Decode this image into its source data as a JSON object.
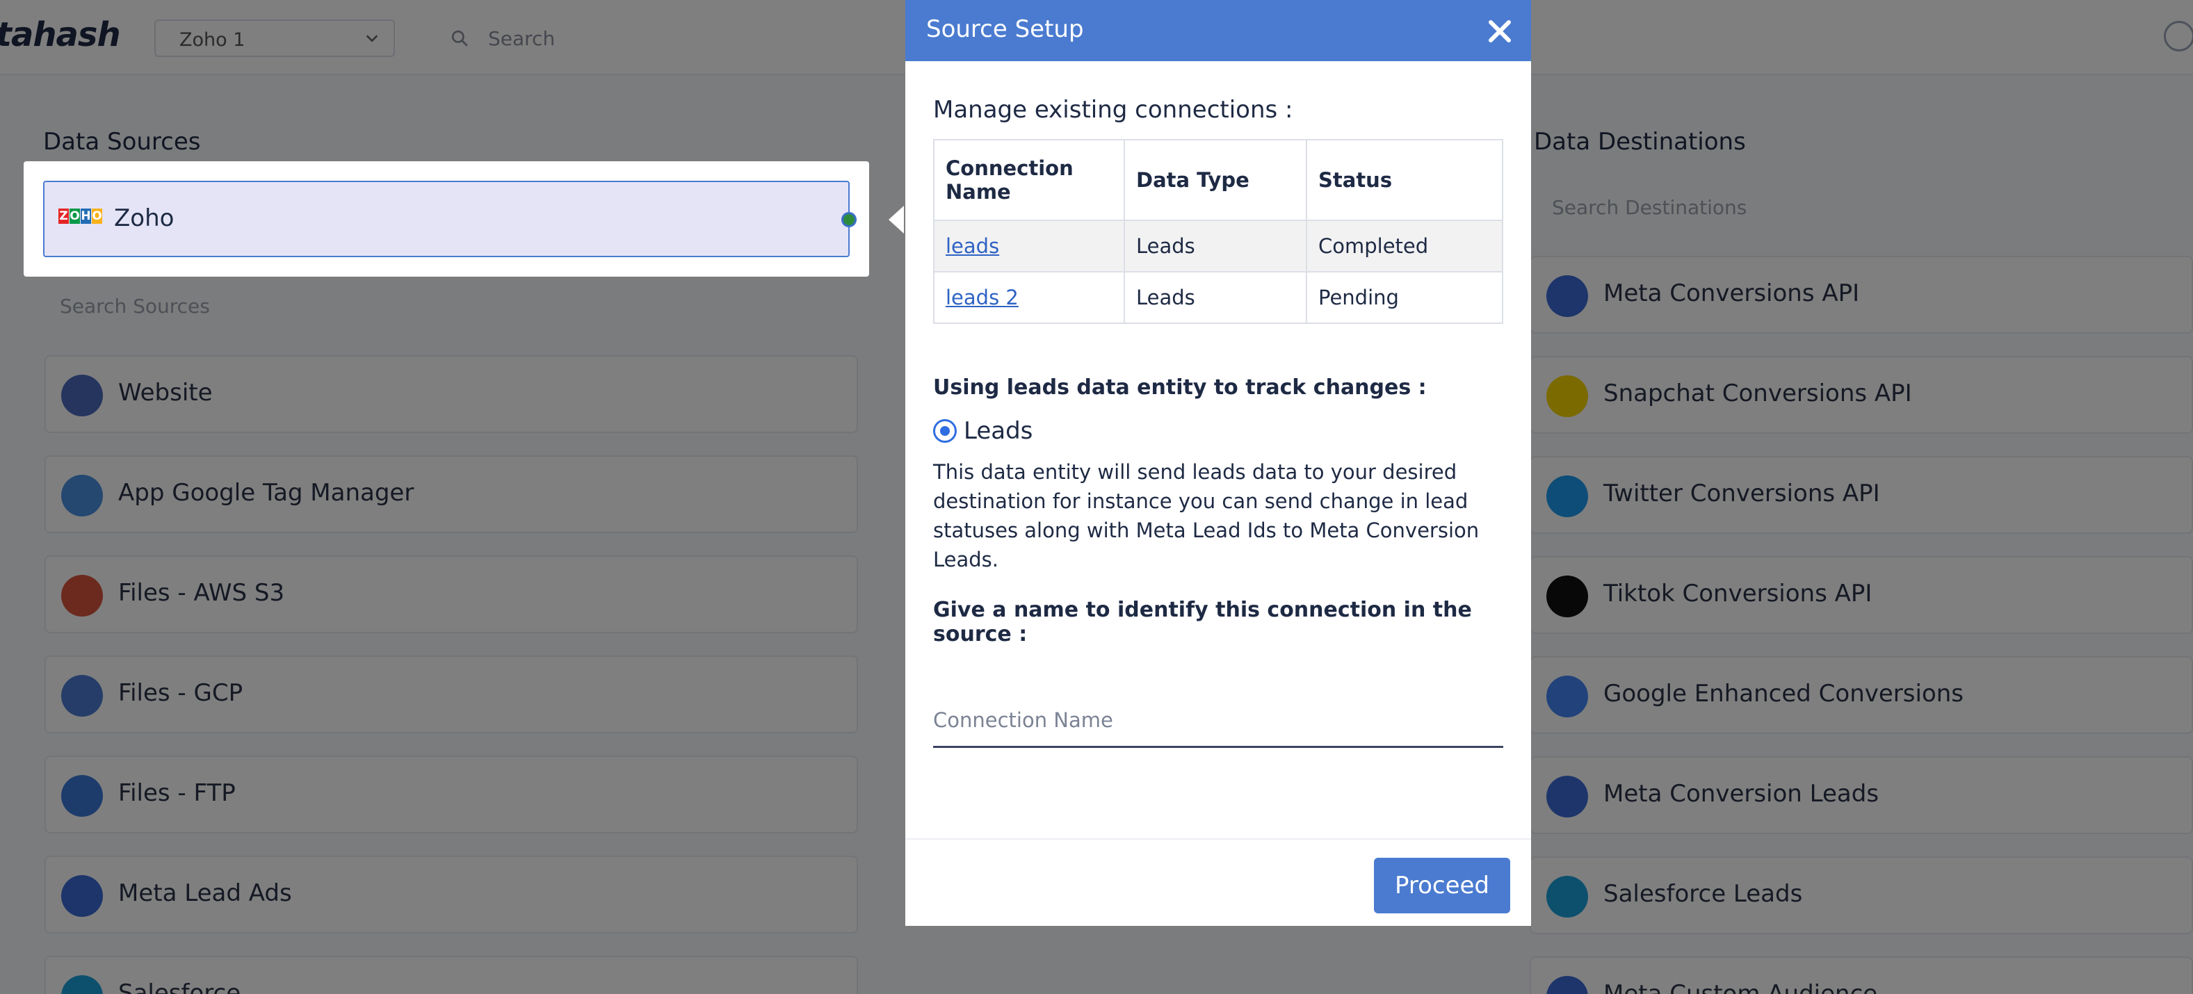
{
  "app": {
    "logo": "tahash",
    "workspace": "Zoho 1",
    "search_placeholder": "Search"
  },
  "sources": {
    "title": "Data Sources",
    "search_placeholder": "Search Sources",
    "selected": "Zoho",
    "items": [
      {
        "label": "Website",
        "icon": "globe-icon",
        "color": "#4b6bbd"
      },
      {
        "label": "App Google Tag Manager",
        "icon": "gtm-icon",
        "color": "#4a90e2"
      },
      {
        "label": "Files - AWS S3",
        "icon": "aws-s3-icon",
        "color": "#d9553d"
      },
      {
        "label": "Files - GCP",
        "icon": "gcp-icon",
        "color": "#4a7bd0"
      },
      {
        "label": "Files - FTP",
        "icon": "ftp-icon",
        "color": "#3a78d8"
      },
      {
        "label": "Meta Lead Ads",
        "icon": "meta-icon",
        "color": "#3b6bd6"
      },
      {
        "label": "Salesforce",
        "icon": "salesforce-icon",
        "color": "#1ba0db"
      }
    ]
  },
  "destinations": {
    "title": "Data Destinations",
    "search_placeholder": "Search Destinations",
    "items": [
      {
        "label": "Meta Conversions API",
        "icon": "meta-icon",
        "color": "#3b6bd6"
      },
      {
        "label": "Snapchat Conversions API",
        "icon": "snapchat-icon",
        "color": "#f5d400"
      },
      {
        "label": "Twitter Conversions API",
        "icon": "twitter-icon",
        "color": "#1d9bf0"
      },
      {
        "label": "Tiktok Conversions API",
        "icon": "tiktok-icon",
        "color": "#111111"
      },
      {
        "label": "Google Enhanced Conversions",
        "icon": "google-ads-icon",
        "color": "#4285f4"
      },
      {
        "label": "Meta Conversion Leads",
        "icon": "meta-icon",
        "color": "#3b6bd6"
      },
      {
        "label": "Salesforce Leads",
        "icon": "salesforce-icon",
        "color": "#1ba0db"
      },
      {
        "label": "Meta Custom Audience",
        "icon": "meta-icon",
        "color": "#3b6bd6"
      }
    ]
  },
  "modal": {
    "title": "Source Setup",
    "manage_label": "Manage existing connections :",
    "table": {
      "headers": [
        "Connection Name",
        "Data Type",
        "Status"
      ],
      "rows": [
        {
          "name": "leads",
          "type": "Leads",
          "status": "Completed"
        },
        {
          "name": "leads 2",
          "type": "Leads",
          "status": "Pending"
        }
      ]
    },
    "entity_label": "Using leads data entity to track changes :",
    "entity_option": "Leads",
    "entity_description": "This data entity will send leads data to your desired destination for instance you can send change in lead statuses along with Meta Lead Ids to Meta Conversion Leads.",
    "name_label": "Give a name to identify this connection in the source :",
    "name_placeholder": "Connection Name",
    "name_value": "",
    "proceed_label": "Proceed"
  },
  "colors": {
    "primary": "#4a7bd0",
    "completed": "#2e9a6d",
    "pending": "#e6900f"
  }
}
